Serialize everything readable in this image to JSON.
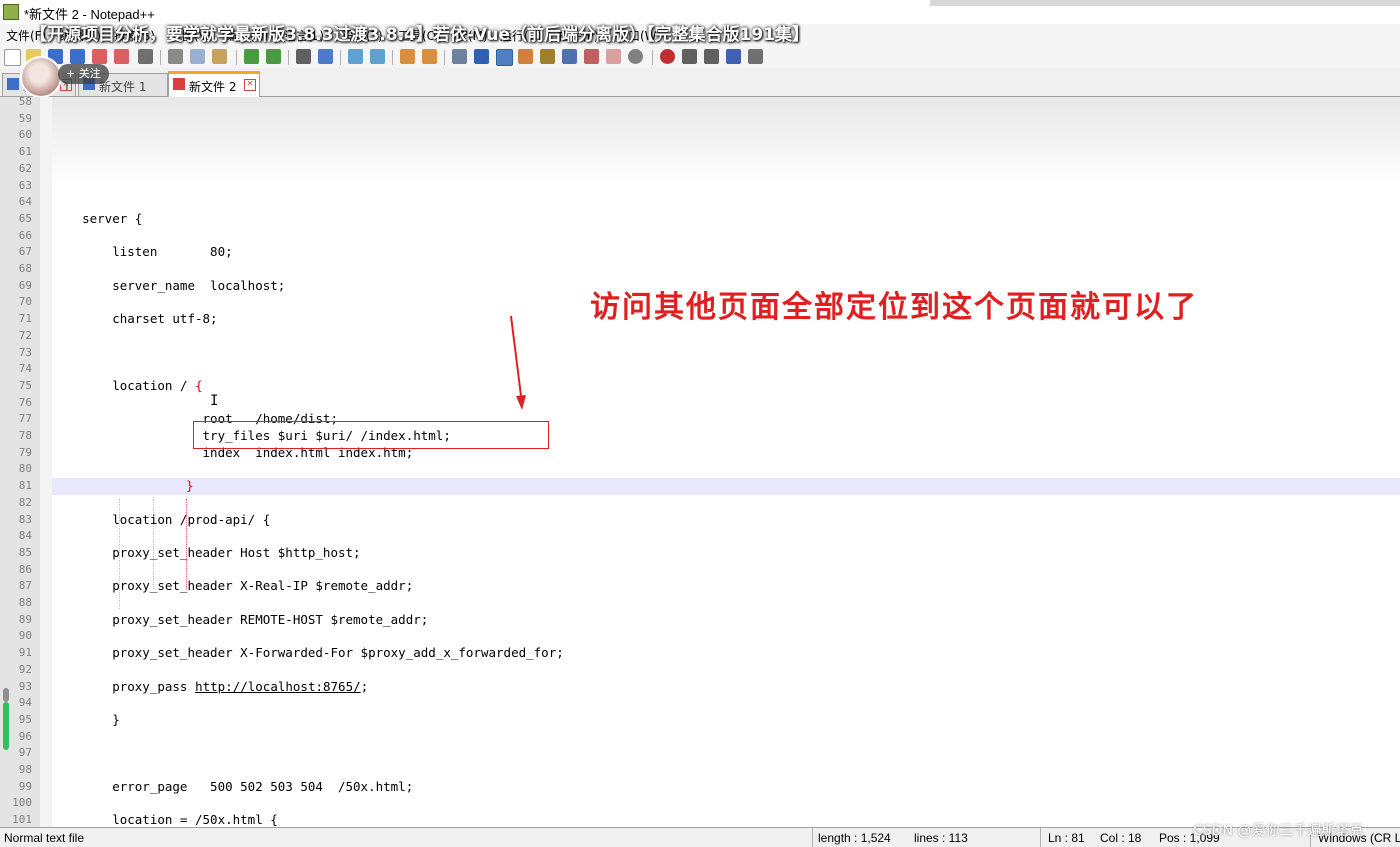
{
  "window": {
    "title": "*新文件 2 - Notepad++"
  },
  "video_overlay": {
    "title": "【开源项目分析，要学就学最新版3.8.3过渡3.8.4】若依-Vue（前后端分离版）【完整集合版191集】",
    "follow_label": "+ 关注"
  },
  "menu": {
    "items": [
      "文件(F)",
      "编辑(E)",
      "搜索(S)",
      "视图(V)",
      "编码(N)",
      "语言(L)",
      "设置(T)",
      "工具(O)",
      "宏(M)",
      "运行(R)",
      "插件(P)",
      "窗口(W)"
    ]
  },
  "tabs": [
    {
      "label": "新文件 1",
      "active": false
    },
    {
      "label": "新文件 1",
      "active": false
    },
    {
      "label": "新文件 2",
      "active": true
    }
  ],
  "editor": {
    "lines": [
      {
        "n": "58",
        "text": ""
      },
      {
        "n": "59",
        "text": ""
      },
      {
        "n": "60",
        "text": ""
      },
      {
        "n": "61",
        "text": ""
      },
      {
        "n": "62",
        "text": ""
      },
      {
        "n": "63",
        "text": ""
      },
      {
        "n": "64",
        "text": ""
      },
      {
        "n": "65",
        "text": "    server {"
      },
      {
        "n": "66",
        "text": ""
      },
      {
        "n": "67",
        "text": "        listen       80;"
      },
      {
        "n": "68",
        "text": ""
      },
      {
        "n": "69",
        "text": "        server_name  localhost;"
      },
      {
        "n": "70",
        "text": ""
      },
      {
        "n": "71",
        "text": "        charset utf-8;"
      },
      {
        "n": "72",
        "text": ""
      },
      {
        "n": "73",
        "text": ""
      },
      {
        "n": "74",
        "text": ""
      },
      {
        "n": "75",
        "text": "        location / "
      },
      {
        "n": "76",
        "text": ""
      },
      {
        "n": "77",
        "text": "                    root   /home/dist;"
      },
      {
        "n": "78",
        "text": "                    try_files $uri $uri/ /index.html;"
      },
      {
        "n": "79",
        "text": "                    index  index.html index.htm;"
      },
      {
        "n": "80",
        "text": ""
      },
      {
        "n": "81",
        "text": ""
      },
      {
        "n": "82",
        "text": ""
      },
      {
        "n": "83",
        "text": "        location /prod-api/ {"
      },
      {
        "n": "84",
        "text": ""
      },
      {
        "n": "85",
        "text": "        proxy_set_header Host $http_host;"
      },
      {
        "n": "86",
        "text": ""
      },
      {
        "n": "87",
        "text": "        proxy_set_header X-Real-IP $remote_addr;"
      },
      {
        "n": "88",
        "text": ""
      },
      {
        "n": "89",
        "text": "        proxy_set_header REMOTE-HOST $remote_addr;"
      },
      {
        "n": "90",
        "text": ""
      },
      {
        "n": "91",
        "text": "        proxy_set_header X-Forwarded-For $proxy_add_x_forwarded_for;"
      },
      {
        "n": "92",
        "text": ""
      },
      {
        "n": "93",
        "text": "        proxy_pass "
      },
      {
        "n": "94",
        "text": ""
      },
      {
        "n": "95",
        "text": "        }"
      },
      {
        "n": "96",
        "text": ""
      },
      {
        "n": "97",
        "text": ""
      },
      {
        "n": "98",
        "text": ""
      },
      {
        "n": "99",
        "text": "        error_page   500 502 503 504  /50x.html;"
      },
      {
        "n": "100",
        "text": ""
      },
      {
        "n": "101",
        "text": "        location = /50x.html {"
      }
    ],
    "open_brace_75": "{",
    "close_brace_81": "}",
    "proxy_url": "http://localhost:8765/",
    "proxy_semicolon": ";",
    "current_line_highlight": "#e8e8ff"
  },
  "annotation": {
    "text": "访问其他页面全部定位到这个页面就可以了",
    "color": "#e02020"
  },
  "status": {
    "file_type": "Normal text file",
    "length": "length : 1,524",
    "lines": "lines : 113",
    "ln": "Ln : 81",
    "col": "Col : 18",
    "pos": "Pos : 1,099",
    "eol": "Windows (CR LF)"
  },
  "watermark": "CSDN @爱你三千遍斯塔克"
}
